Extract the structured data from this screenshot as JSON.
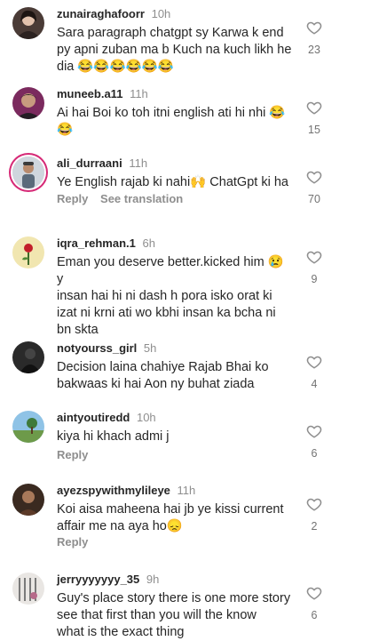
{
  "comments": [
    {
      "username": "zunairaghafoorr",
      "time": "10h",
      "text": "Sara paragraph chatgpt sy Karwa k end\npy apni zuban ma b Kuch na kuch likh he\ndia 😂😂😂😂😂😂",
      "likes": "23",
      "reply_label": "",
      "see_translation_label": ""
    },
    {
      "username": "muneeb.a11",
      "time": "11h",
      "text": "Ai hai Boi ko toh itni english ati hi nhi 😂\n😂",
      "likes": "15",
      "reply_label": "",
      "see_translation_label": ""
    },
    {
      "username": "ali_durraani",
      "time": "11h",
      "text": "Ye English rajab ki nahi🙌 ChatGpt ki ha",
      "likes": "70",
      "reply_label": "Reply",
      "see_translation_label": "See translation"
    },
    {
      "username": "iqra_rehman.1",
      "time": "6h",
      "text": "Eman you deserve better.kicked him 😢 y\ninsan hai hi ni dash h pora isko orat ki\nizat ni krni ati wo kbhi insan ka bcha ni\nbn skta",
      "likes": "9",
      "reply_label": "",
      "see_translation_label": ""
    },
    {
      "username": "notyourss_girl",
      "time": "5h",
      "text": "Decision laina chahiye Rajab Bhai ko\nbakwaas ki hai Aon ny buhat ziada",
      "likes": "4",
      "reply_label": "",
      "see_translation_label": ""
    },
    {
      "username": "aintyoutiredd",
      "time": "10h",
      "text": "kiya hi khach admi j",
      "likes": "6",
      "reply_label": "Reply",
      "see_translation_label": ""
    },
    {
      "username": "ayezspywithmylileye",
      "time": "11h",
      "text": "Koi aisa maheena hai jb ye kissi current\naffair me na aya ho😞",
      "likes": "2",
      "reply_label": "Reply",
      "see_translation_label": ""
    },
    {
      "username": "jerryyyyyyy_35",
      "time": "9h",
      "text": "Guy's place story there is one more story\nsee that first than you will the know\nwhat is the exact thing",
      "likes": "6",
      "reply_label": "",
      "see_translation_label": ""
    }
  ],
  "icons": {
    "like": "heart-outline-icon",
    "avatar": "user-avatar"
  }
}
